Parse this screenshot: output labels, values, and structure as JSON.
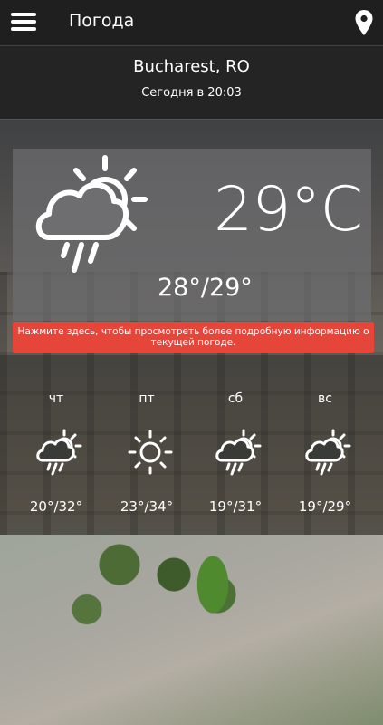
{
  "appbar": {
    "title": "Погода"
  },
  "location": {
    "city": "Bucharest, RO",
    "updated": "Сегодня в 20:03"
  },
  "current": {
    "temperature": "29°C",
    "range": "28°/29°",
    "icon": "rain-sun-cloud-icon"
  },
  "info_banner": "Нажмите здесь, чтобы просмотреть более подробную информацию о текущей погоде.",
  "forecast": [
    {
      "day": "чт",
      "range": "20°/32°",
      "icon": "rain-sun-cloud-icon"
    },
    {
      "day": "пт",
      "range": "23°/34°",
      "icon": "sun-icon"
    },
    {
      "day": "сб",
      "range": "19°/31°",
      "icon": "rain-sun-cloud-icon"
    },
    {
      "day": "вс",
      "range": "19°/29°",
      "icon": "rain-sun-cloud-icon"
    }
  ],
  "colors": {
    "accent": "#e6453a",
    "appbar": "#1f1f1f"
  }
}
